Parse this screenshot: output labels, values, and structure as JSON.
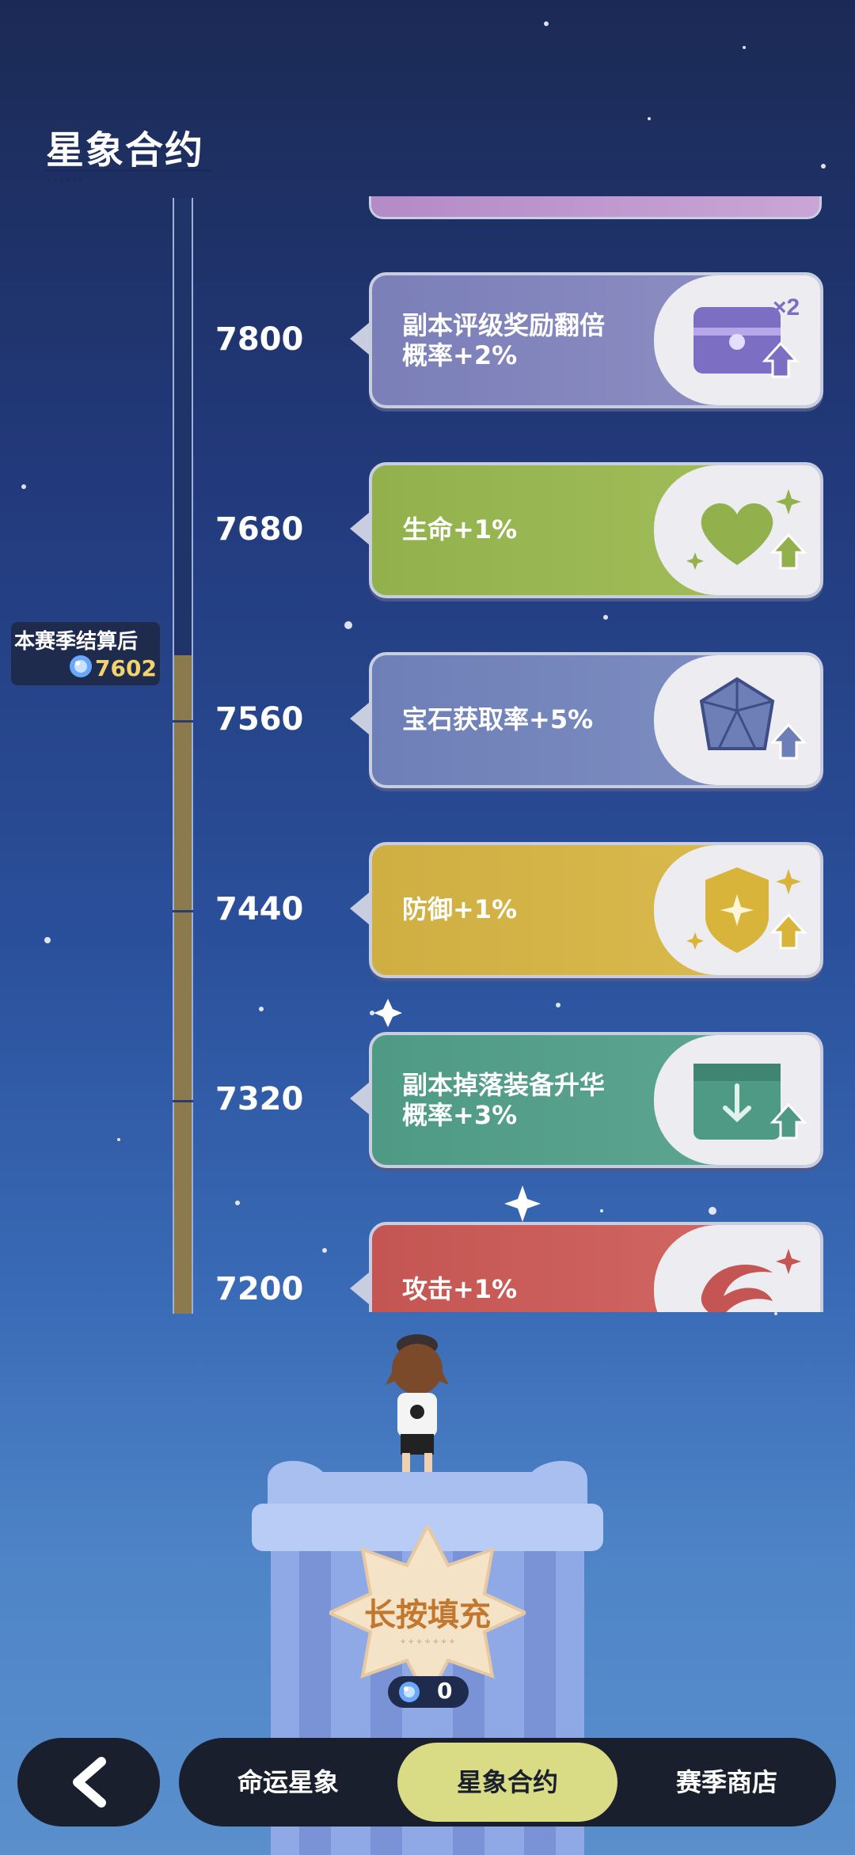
{
  "title": "星象合约",
  "season": {
    "label": "本赛季结算后",
    "value": "7602"
  },
  "tiers": [
    {
      "level": "7800",
      "label_line1": "副本评级奖励翻倍",
      "label_line2": "概率+2%",
      "color": "#8f90c4",
      "icon": "chest-x2-icon",
      "icon_text": "×2"
    },
    {
      "level": "7680",
      "label_line1": "生命+1%",
      "label_line2": "",
      "color": "#a3bf5a",
      "icon": "heart-icon"
    },
    {
      "level": "7560",
      "label_line1": "宝石获取率+5%",
      "label_line2": "",
      "color": "#8090c2",
      "icon": "gem-icon"
    },
    {
      "level": "7440",
      "label_line1": "防御+1%",
      "label_line2": "",
      "color": "#dcbc4f",
      "icon": "shield-icon"
    },
    {
      "level": "7320",
      "label_line1": "副本掉落装备升华",
      "label_line2": "概率+3%",
      "color": "#5fa894",
      "icon": "box-icon"
    },
    {
      "level": "7200",
      "label_line1": "攻击+1%",
      "label_line2": "",
      "color": "#d46a66",
      "icon": "attack-icon"
    }
  ],
  "fill_button": {
    "label": "长按填充"
  },
  "counter": {
    "value": "0"
  },
  "nav": {
    "back_icon": "back-arrow-icon",
    "tabs": [
      {
        "label": "命运星象",
        "active": false
      },
      {
        "label": "星象合约",
        "active": true
      },
      {
        "label": "赛季商店",
        "active": false
      }
    ]
  }
}
